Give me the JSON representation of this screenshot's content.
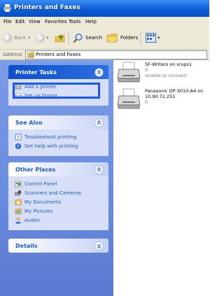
{
  "window": {
    "title": "Printers and Faxes"
  },
  "menu": [
    "File",
    "Edit",
    "View",
    "Favorites",
    "Tools",
    "Help"
  ],
  "toolbar": {
    "back": "Back",
    "search": "Search",
    "folders": "Folders"
  },
  "address": {
    "label": "Address",
    "value": "Printers and Faxes"
  },
  "sidebar": {
    "printer_tasks": {
      "title": "Printer Tasks",
      "items": [
        "Add a printer",
        "Set up faxing"
      ]
    },
    "see_also": {
      "title": "See Also",
      "items": [
        "Troubleshoot printing",
        "Get help with printing"
      ]
    },
    "other_places": {
      "title": "Other Places",
      "items": [
        "Control Panel",
        "Scanners and Cameras",
        "My Documents",
        "My Pictures",
        "Austin"
      ]
    },
    "details": {
      "title": "Details"
    }
  },
  "printers": [
    {
      "name": "SF-Writers on srvps1",
      "name2": "",
      "documents": "0",
      "status": "Unable to connect"
    },
    {
      "name": "Panasonic DP-3010-A4 on",
      "name2": "10.90.72.251",
      "documents": "0",
      "status": ""
    }
  ]
}
